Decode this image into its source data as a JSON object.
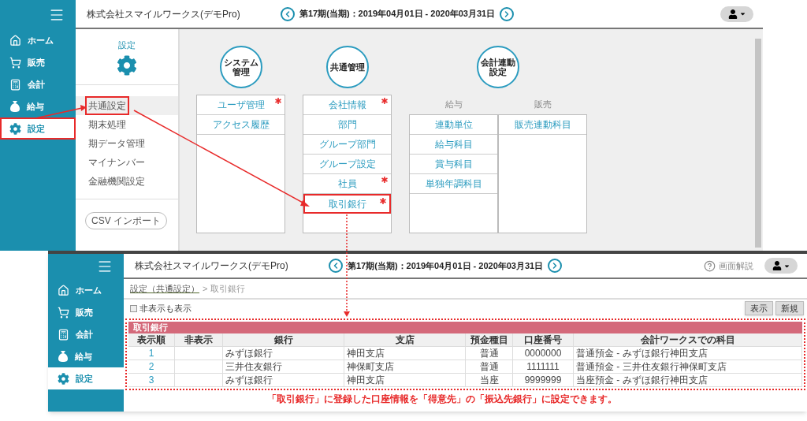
{
  "screen_1": {
    "sidebar": {
      "items": [
        {
          "label": "ホーム",
          "kind": "home",
          "selected": false,
          "highlighted": false
        },
        {
          "label": "販売",
          "kind": "sales",
          "selected": false,
          "highlighted": false
        },
        {
          "label": "会計",
          "kind": "accounting",
          "selected": false,
          "highlighted": false
        },
        {
          "label": "給与",
          "kind": "payroll",
          "selected": false,
          "highlighted": false
        },
        {
          "label": "設定",
          "kind": "settings",
          "selected": true,
          "highlighted": true
        }
      ]
    },
    "company": "株式会社スマイルワークス(デモPro)",
    "period": "第17期(当期)：2019年04月01日 - 2020年03月31日",
    "settings_panel": {
      "title": "設定",
      "menu": [
        {
          "label": "共通設定",
          "selected": true,
          "highlighted": true
        },
        {
          "label": "期末処理",
          "selected": false,
          "highlighted": false
        },
        {
          "label": "期データ管理",
          "selected": false,
          "highlighted": false
        },
        {
          "label": "マイナンバー",
          "selected": false,
          "highlighted": false
        },
        {
          "label": "金融機関設定",
          "selected": false,
          "highlighted": false
        }
      ],
      "import_button": "CSV インポート"
    },
    "groups": [
      {
        "title": "システム管理",
        "columns": [
          {
            "items": [
              {
                "label": "ユーザ管理",
                "required": true,
                "highlighted": false
              },
              {
                "label": "アクセス履歴",
                "required": false,
                "highlighted": false
              }
            ]
          }
        ]
      },
      {
        "title": "共通管理",
        "columns": [
          {
            "items": [
              {
                "label": "会社情報",
                "required": true,
                "highlighted": false
              },
              {
                "label": "部門",
                "required": false,
                "highlighted": false
              },
              {
                "label": "グループ部門",
                "required": false,
                "highlighted": false
              },
              {
                "label": "グループ設定",
                "required": false,
                "highlighted": false
              },
              {
                "label": "社員",
                "required": true,
                "highlighted": false
              },
              {
                "label": "取引銀行",
                "required": true,
                "highlighted": true
              }
            ]
          }
        ]
      },
      {
        "title": "会計連動設定",
        "columns": [
          {
            "heading": "給与",
            "items": [
              {
                "label": "連動単位",
                "required": false,
                "highlighted": false
              },
              {
                "label": "給与科目",
                "required": false,
                "highlighted": false
              },
              {
                "label": "賞与科目",
                "required": false,
                "highlighted": false
              },
              {
                "label": "単独年調科目",
                "required": false,
                "highlighted": false
              }
            ]
          },
          {
            "heading": "販売",
            "items": [
              {
                "label": "販売連動科目",
                "required": false,
                "highlighted": false
              }
            ]
          }
        ]
      }
    ]
  },
  "screen_2": {
    "sidebar": {
      "items": [
        {
          "label": "ホーム",
          "kind": "home",
          "selected": false,
          "highlighted": false
        },
        {
          "label": "販売",
          "kind": "sales",
          "selected": false,
          "highlighted": false
        },
        {
          "label": "会計",
          "kind": "accounting",
          "selected": false,
          "highlighted": false
        },
        {
          "label": "給与",
          "kind": "payroll",
          "selected": false,
          "highlighted": false
        },
        {
          "label": "設定",
          "kind": "settings",
          "selected": true,
          "highlighted": false
        }
      ]
    },
    "company": "株式会社スマイルワークス(デモPro)",
    "period": "第17期(当期)：2019年04月01日 - 2020年03月31日",
    "help": "画面解説",
    "breadcrumb": {
      "link": "設定（共通設定）",
      "separator": ">",
      "current": "取引銀行"
    },
    "show_hidden": {
      "label": "非表示も表示",
      "checked": false
    },
    "buttons": [
      "表示",
      "新規"
    ],
    "table": {
      "title": "取引銀行",
      "columns": [
        "表示順",
        "非表示",
        "銀行",
        "支店",
        "預金種目",
        "口座番号",
        "会計ワークスでの科目"
      ],
      "rows": [
        [
          "1",
          "",
          "みずほ銀行",
          "神田支店",
          "普通",
          "0000000",
          "普通預金 - みずほ銀行神田支店"
        ],
        [
          "2",
          "",
          "三井住友銀行",
          "神保町支店",
          "普通",
          "1111111",
          "普通預金 - 三井住友銀行神保町支店"
        ],
        [
          "3",
          "",
          "みずほ銀行",
          "神田支店",
          "当座",
          "9999999",
          "当座預金 - みずほ銀行神田支店"
        ]
      ]
    }
  },
  "caption": "「取引銀行」に登録した口座情報を「得意先」の「振込先銀行」に設定できます。"
}
